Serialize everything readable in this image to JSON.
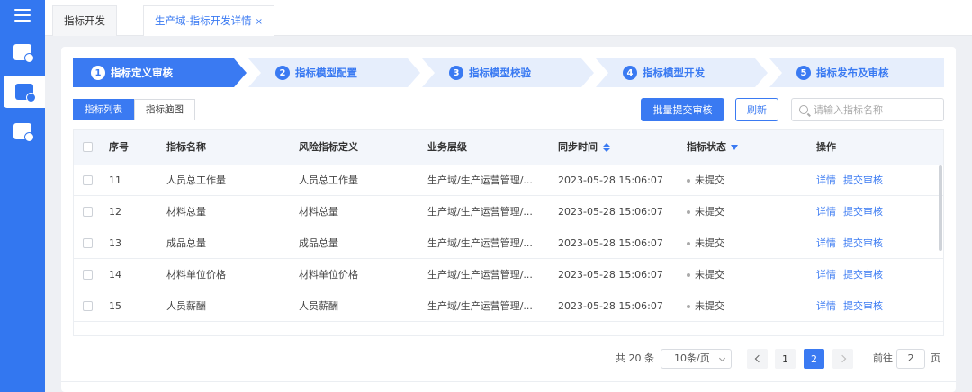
{
  "tabs": [
    {
      "label": "指标开发"
    },
    {
      "label": "生产域-指标开发详情",
      "close": "×"
    }
  ],
  "steps": [
    {
      "num": "1",
      "label": "指标定义审核"
    },
    {
      "num": "2",
      "label": "指标模型配置"
    },
    {
      "num": "3",
      "label": "指标模型校验"
    },
    {
      "num": "4",
      "label": "指标模型开发"
    },
    {
      "num": "5",
      "label": "指标发布及审核"
    }
  ],
  "toolbar": {
    "view_list": "指标列表",
    "view_graph": "指标脑图",
    "batch_submit": "批量提交审核",
    "refresh": "刷新",
    "search_placeholder": "请输入指标名称"
  },
  "table": {
    "headers": [
      "序号",
      "指标名称",
      "风险指标定义",
      "业务层级",
      "同步时间",
      "指标状态",
      "操作"
    ],
    "rows": [
      {
        "no": "11",
        "name": "人员总工作量",
        "definition": "人员总工作量",
        "level": "生产域/生产运营管理/...",
        "time": "2023-05-28 15:06:07",
        "status": "未提交"
      },
      {
        "no": "12",
        "name": "材料总量",
        "definition": "材料总量",
        "level": "生产域/生产运营管理/...",
        "time": "2023-05-28 15:06:07",
        "status": "未提交"
      },
      {
        "no": "13",
        "name": "成品总量",
        "definition": "成品总量",
        "level": "生产域/生产运营管理/...",
        "time": "2023-05-28 15:06:07",
        "status": "未提交"
      },
      {
        "no": "14",
        "name": "材料单位价格",
        "definition": "材料单位价格",
        "level": "生产域/生产运营管理/...",
        "time": "2023-05-28 15:06:07",
        "status": "未提交"
      },
      {
        "no": "15",
        "name": "人员薪酬",
        "definition": "人员薪酬",
        "level": "生产域/生产运营管理/...",
        "time": "2023-05-28 15:06:07",
        "status": "未提交"
      }
    ],
    "actions": {
      "detail": "详情",
      "submit": "提交审核"
    }
  },
  "pagination": {
    "total": "共 20 条",
    "page_size": "10条/页",
    "pages": [
      "1",
      "2"
    ],
    "current": "2",
    "goto_label": "前往",
    "goto_value": "2",
    "goto_unit": "页"
  },
  "colors": {
    "primary": "#3a7af2",
    "sidebar": "#3377f0"
  }
}
